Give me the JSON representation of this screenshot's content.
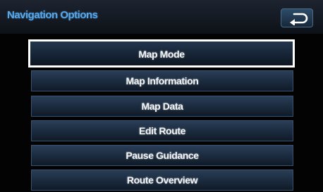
{
  "header": {
    "title": "Navigation Options",
    "back_icon": "back-arrow-icon"
  },
  "menu": {
    "items": [
      {
        "label": "Map Mode",
        "selected": true
      },
      {
        "label": "Map Information",
        "selected": false
      },
      {
        "label": "Map Data",
        "selected": false
      },
      {
        "label": "Edit Route",
        "selected": false
      },
      {
        "label": "Pause Guidance",
        "selected": false
      },
      {
        "label": "Route Overview",
        "selected": false
      }
    ]
  },
  "colors": {
    "title": "#58a8ea",
    "button_top": "#2a3e57",
    "button_bottom": "#101a27",
    "selection_border": "#ffffff",
    "background": "#030303"
  }
}
